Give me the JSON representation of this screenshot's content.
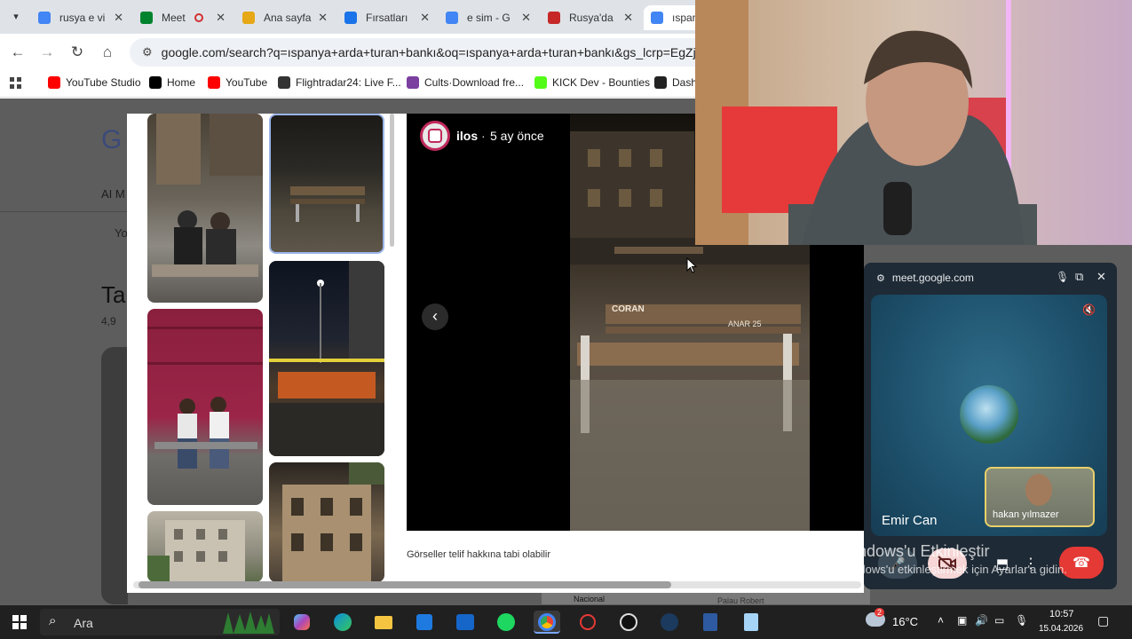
{
  "browser": {
    "tabs": [
      {
        "title": "rusya e vi",
        "icon": "google-g-icon",
        "color": "#4285f4"
      },
      {
        "title": "Meet",
        "icon": "meet-icon",
        "color": "#00832d",
        "recording": true
      },
      {
        "title": "Ana sayfa",
        "icon": "homepage-icon",
        "color": "#e6a817"
      },
      {
        "title": "Fırsatları",
        "icon": "spark-icon",
        "color": "#1a73e8"
      },
      {
        "title": "e sim - G",
        "icon": "google-g-icon",
        "color": "#4285f4"
      },
      {
        "title": "Rusya'da",
        "icon": "360-icon",
        "color": "#c62828"
      },
      {
        "title": "ıspan",
        "icon": "google-g-icon",
        "color": "#4285f4"
      }
    ],
    "url": "google.com/search?q=ıspanya+arda+turan+bankı&oq=ıspanya+arda+turan+bankı&gs_lcrp=EgZjaHJvb",
    "bookmarks": [
      {
        "label": "YouTube Studio",
        "icon": "youtube-studio-icon",
        "color": "#ff0000"
      },
      {
        "label": "Home",
        "icon": "x-logo-icon",
        "color": "#000000"
      },
      {
        "label": "YouTube",
        "icon": "youtube-icon",
        "color": "#ff0000"
      },
      {
        "label": "Flightradar24: Live F...",
        "icon": "flightradar-icon",
        "color": "#333333"
      },
      {
        "label": "Cults·Download fre...",
        "icon": "cults-icon",
        "color": "#7b3fa0"
      },
      {
        "label": "KICK Dev - Bounties",
        "icon": "kick-icon",
        "color": "#53fc18"
      },
      {
        "label": "Dash",
        "icon": "dash-icon",
        "color": "#222222"
      }
    ]
  },
  "background_page": {
    "logo_partial": "G",
    "tab_partial": "AI M",
    "chip_partial": "Yo",
    "heading_partial": "Ta",
    "rating_partial": "4,9",
    "map_label": "Nacional",
    "map_label2": "Palau Robert"
  },
  "viewer": {
    "source_name": "ilos",
    "age": "5 ay önce",
    "separator": "·",
    "copyright_note": "Görseller telif hakkına tabi olabilir",
    "bench_text_1": "CORAN",
    "bench_text_2": "ANAR 25"
  },
  "meet": {
    "domain": "meet.google.com",
    "main_participant": "Emir Can",
    "self_participant": "hakan yılmazer",
    "colors": {
      "end_call": "#e53935",
      "camera_off": "#f6d6d6"
    }
  },
  "watermark": {
    "line1": "Windows'u Etkinleştir",
    "line2": "Windows'u etkinleştirmek için Ayarlar'a gidin."
  },
  "taskbar": {
    "search_label": "Ara",
    "temperature": "16°C",
    "time": "10:57",
    "date": "15.04.2026",
    "weather_badge": "2"
  }
}
